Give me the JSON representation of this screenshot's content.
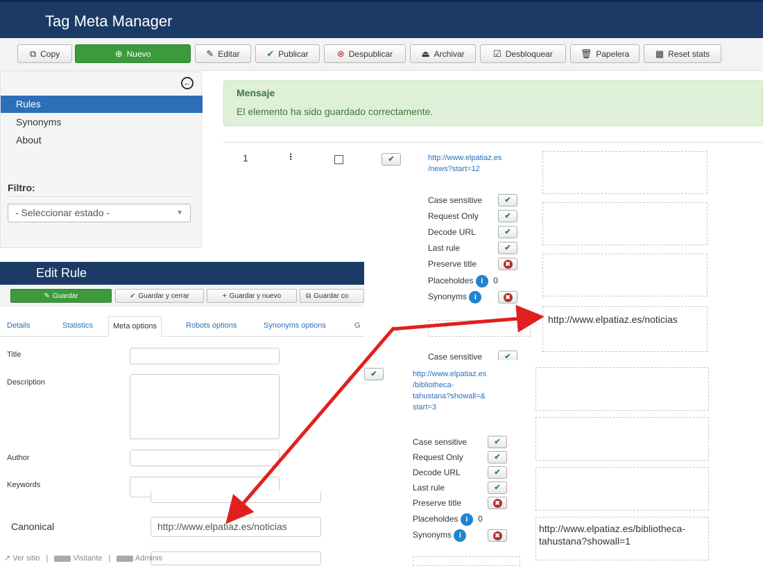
{
  "app": {
    "title": "Tag Meta Manager"
  },
  "toolbar": {
    "copy": "Copy",
    "nuevo": "Nuevo",
    "editar": "Editar",
    "publicar": "Publicar",
    "despublicar": "Despublicar",
    "archivar": "Archivar",
    "desbloquear": "Desbloquear",
    "papelera": "Papelera",
    "reset_stats": "Reset stats"
  },
  "sidebar": {
    "items": [
      {
        "label": "Rules"
      },
      {
        "label": "Synonyms"
      },
      {
        "label": "About"
      }
    ],
    "filter_label": "Filtro:",
    "filter_value": "- Seleccionar estado -"
  },
  "message": {
    "title": "Mensaje",
    "text": "El elemento ha sido guardado correctamente."
  },
  "list": {
    "row1": {
      "num": "1",
      "url": [
        "http://www.elpatiaz.es",
        "/news?start=12"
      ],
      "options": [
        "Case sensitive",
        "Request Only",
        "Decode URL",
        "Last rule",
        "Preserve title",
        "Placeholdes",
        "Synonyms"
      ],
      "placeholders_count": "0",
      "canonical": "http://www.elpatiaz.es/noticias",
      "next_option": "Case sensitive"
    },
    "row2": {
      "url": [
        "http://www.elpatiaz.es",
        "/bibliotheca-",
        "tahustana?showall=&",
        "start=3"
      ],
      "options": [
        "Case sensitive",
        "Request Only",
        "Decode URL",
        "Last rule",
        "Preserve title",
        "Placeholdes",
        "Synonyms"
      ],
      "placeholders_count": "0",
      "canonical": [
        "http://www.elpatiaz.es/bibliotheca-",
        "tahustana?showall=1"
      ]
    }
  },
  "edit_rule": {
    "title": "Edit Rule",
    "buttons": {
      "guardar": "Guardar",
      "guardar_cerrar": "Guardar y cerrar",
      "guardar_nuevo": "Guardar y nuevo",
      "guardar_copia": "Guardar co"
    },
    "tabs": [
      "Details",
      "Statistics",
      "Meta options",
      "Robots options",
      "Synonyms options",
      "G"
    ],
    "fields": {
      "title": "Title",
      "description": "Description",
      "author": "Author",
      "keywords": "Keywords",
      "canonical": "Canonical"
    },
    "canonical_value": "http://www.elpatiaz.es/noticias"
  },
  "statusbar": {
    "ver_sitio": "Ver sitio",
    "visitante": "Visitante",
    "admin": "Adminis"
  },
  "colors": {
    "header": "#1b3a66",
    "accent": "#2c6fb8",
    "green": "#3c9a3c",
    "arrow": "#e0201f"
  }
}
